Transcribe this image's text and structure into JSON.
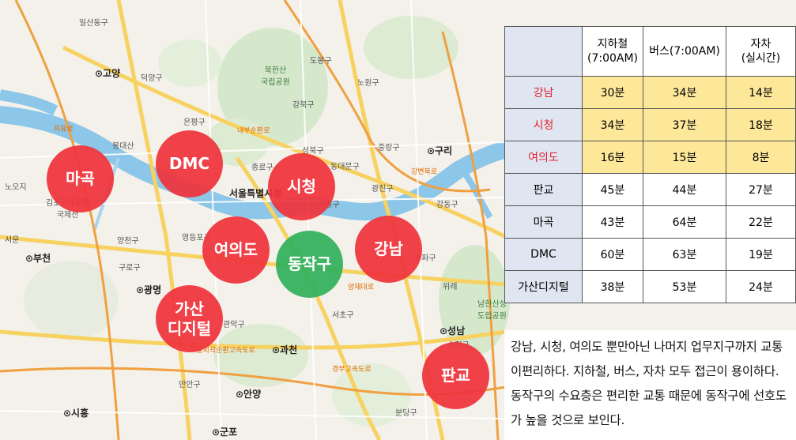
{
  "map": {
    "labels": {
      "ilsan_east": "일산동구",
      "goyang": "⊙고양",
      "deogyang": "덕양구",
      "bukhansan": "북한산\n국립공원",
      "dobong": "도봉구",
      "nowon": "노원구",
      "gangbuk": "강북구",
      "eunpyeong": "은평구",
      "jayuro": "자유로",
      "bonghwa": "봉대산",
      "seongbuk": "성북구",
      "jungnang": "중랑구",
      "guri": "⊙구리",
      "dongdaemun": "동대문구",
      "seoul_city": "서울특별시청",
      "jongno": "종로구",
      "seongdong": "성동구",
      "gwangjin": "광진구",
      "gangdong": "강동구",
      "songpa": "송파구",
      "gimpo_airport": "김포국제공항\n국제선",
      "yangcheon": "양천구",
      "bucheon": "⊙부천",
      "guro": "구로구",
      "yeongdeungpo": "영등포구",
      "gwangmyeong": "⊙광명",
      "gwanak": "관악구",
      "gwacheon": "⊙과천",
      "anyang": "⊙안양",
      "manan": "만안구",
      "siheung": "⊙시흥",
      "gunpo": "⊙군포",
      "seongnam": "⊙성남",
      "sujeong": "수정구",
      "bundang": "분당구",
      "namhansan": "남한산성\n도립공원",
      "seocho": "서초구",
      "nowon_road": "노오지",
      "seowon": "서운",
      "yangju": "위례",
      "road_gyeongbu": "경부고속도로",
      "road_outer": "서울외곽순환고속도로",
      "road_gangbyeon": "강변북로",
      "road_naebu": "내부순환로",
      "road_yangjae": "양재대로"
    },
    "circles": {
      "magok": "마곡",
      "dmc": "DMC",
      "sicheong": "시청",
      "yeouido": "여의도",
      "dongjak": "동작구",
      "gangnam": "강남",
      "gasan": "가산\n디지털",
      "pangyo": "판교"
    }
  },
  "table": {
    "headers": [
      "",
      "지하철\n(7:00AM)",
      "버스(7:00AM)",
      "자차\n(실시간)"
    ],
    "rows": [
      {
        "name": "강남",
        "subway": "30분",
        "bus": "34분",
        "car": "14분",
        "highlight": true
      },
      {
        "name": "시청",
        "subway": "34분",
        "bus": "37분",
        "car": "18분",
        "highlight": true
      },
      {
        "name": "여의도",
        "subway": "16분",
        "bus": "15분",
        "car": "8분",
        "highlight": true
      },
      {
        "name": "판교",
        "subway": "45분",
        "bus": "44분",
        "car": "27분",
        "highlight": false
      },
      {
        "name": "마곡",
        "subway": "43분",
        "bus": "64분",
        "car": "22분",
        "highlight": false
      },
      {
        "name": "DMC",
        "subway": "60분",
        "bus": "63분",
        "car": "19분",
        "highlight": false
      },
      {
        "name": "가산디지털",
        "subway": "38분",
        "bus": "53분",
        "car": "24분",
        "highlight": false
      }
    ],
    "colors": {
      "header_bg": "#dfe5f1",
      "highlight_bg": "#fde89a",
      "highlight_text": "#e4232b"
    }
  },
  "note": "강남, 시청, 여의도 뿐만아닌 나머지 업무지구까지 교통이편리하다.  지하철, 버스, 자차 모두 접근이 용이하다. 동작구의 수요층은 편리한 교통 때문에 동작구에 선호도가 높을 것으로 보인다."
}
